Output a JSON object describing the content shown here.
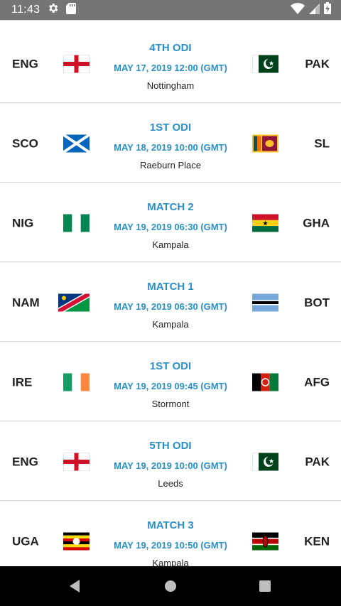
{
  "status_bar": {
    "time": "11:43",
    "icons": [
      "gear-icon",
      "sd-card-icon",
      "wifi-icon",
      "signal-icon",
      "battery-icon"
    ]
  },
  "colors": {
    "accent": "#2a8fc7",
    "status_bar": "#757575",
    "nav_bar": "#000000"
  },
  "matches": [
    {
      "title": "4TH ODI",
      "datetime": "MAY 17, 2019 12:00 (GMT)",
      "venue": "Nottingham",
      "home": {
        "code": "ENG",
        "flag": "england-flag-icon"
      },
      "away": {
        "code": "PAK",
        "flag": "pakistan-flag-icon"
      }
    },
    {
      "title": "1ST ODI",
      "datetime": "MAY 18, 2019 10:00 (GMT)",
      "venue": "Raeburn Place",
      "home": {
        "code": "SCO",
        "flag": "scotland-flag-icon"
      },
      "away": {
        "code": "SL",
        "flag": "sri-lanka-flag-icon"
      }
    },
    {
      "title": "MATCH 2",
      "datetime": "MAY 19, 2019 06:30 (GMT)",
      "venue": "Kampala",
      "home": {
        "code": "NIG",
        "flag": "nigeria-flag-icon"
      },
      "away": {
        "code": "GHA",
        "flag": "ghana-flag-icon"
      }
    },
    {
      "title": "MATCH 1",
      "datetime": "MAY 19, 2019 06:30 (GMT)",
      "venue": "Kampala",
      "home": {
        "code": "NAM",
        "flag": "namibia-flag-icon"
      },
      "away": {
        "code": "BOT",
        "flag": "botswana-flag-icon"
      }
    },
    {
      "title": "1ST ODI",
      "datetime": "MAY 19, 2019 09:45 (GMT)",
      "venue": "Stormont",
      "home": {
        "code": "IRE",
        "flag": "ireland-flag-icon"
      },
      "away": {
        "code": "AFG",
        "flag": "afghanistan-flag-icon"
      }
    },
    {
      "title": "5TH ODI",
      "datetime": "MAY 19, 2019 10:00 (GMT)",
      "venue": "Leeds",
      "home": {
        "code": "ENG",
        "flag": "england-flag-icon"
      },
      "away": {
        "code": "PAK",
        "flag": "pakistan-flag-icon"
      }
    },
    {
      "title": "MATCH 3",
      "datetime": "MAY 19, 2019 10:50 (GMT)",
      "venue": "Kampala",
      "home": {
        "code": "UGA",
        "flag": "uganda-flag-icon"
      },
      "away": {
        "code": "KEN",
        "flag": "kenya-flag-icon"
      }
    }
  ],
  "nav_bar": {
    "buttons": [
      "back-icon",
      "home-icon",
      "recents-icon"
    ]
  }
}
